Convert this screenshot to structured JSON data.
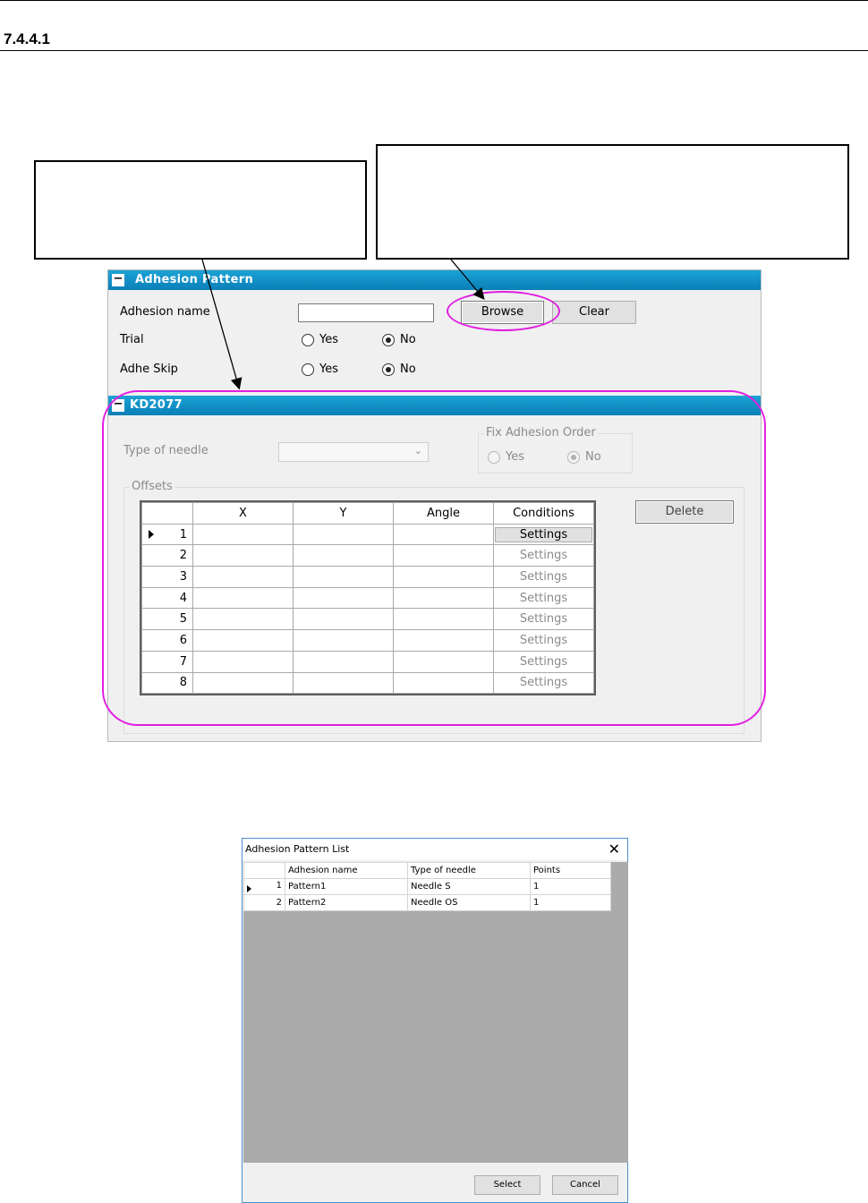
{
  "page": {
    "section_number": "7.4.4.1"
  },
  "adhesion_pattern": {
    "header": "Adhesion Pattern",
    "collapse_glyph": "−",
    "adhesion_name_label": "Adhesion name",
    "adhesion_name_value": "",
    "browse_label": "Browse",
    "clear_label": "Clear",
    "trial_label": "Trial",
    "adhe_skip_label": "Adhe Skip",
    "yes_label": "Yes",
    "no_label": "No",
    "trial_selected": "No",
    "adhe_skip_selected": "No"
  },
  "kd_section": {
    "header": "KD2077",
    "type_of_needle_label": "Type of needle",
    "type_of_needle_value": "",
    "fix_order_label": "Fix Adhesion Order",
    "yes_label": "Yes",
    "no_label": "No",
    "fix_order_selected": "No",
    "offsets_label": "Offsets",
    "delete_label": "Delete",
    "columns": [
      "",
      "X",
      "Y",
      "Angle",
      "Conditions"
    ],
    "rows": [
      {
        "num": "1",
        "x": "",
        "y": "",
        "angle": "",
        "cond": "Settings"
      },
      {
        "num": "2",
        "x": "",
        "y": "",
        "angle": "",
        "cond": "Settings"
      },
      {
        "num": "3",
        "x": "",
        "y": "",
        "angle": "",
        "cond": "Settings"
      },
      {
        "num": "4",
        "x": "",
        "y": "",
        "angle": "",
        "cond": "Settings"
      },
      {
        "num": "5",
        "x": "",
        "y": "",
        "angle": "",
        "cond": "Settings"
      },
      {
        "num": "6",
        "x": "",
        "y": "",
        "angle": "",
        "cond": "Settings"
      },
      {
        "num": "7",
        "x": "",
        "y": "",
        "angle": "",
        "cond": "Settings"
      },
      {
        "num": "8",
        "x": "",
        "y": "",
        "angle": "",
        "cond": "Settings"
      }
    ]
  },
  "colors": {
    "highlight": "#e11ee1",
    "header_bar": "#1591c9"
  },
  "dialog": {
    "title": "Adhesion Pattern List",
    "close_glyph": "✕",
    "columns": [
      "",
      "Adhesion name",
      "Type of needle",
      "Points"
    ],
    "rows": [
      {
        "num": "1",
        "name": "Pattern1",
        "needle": "Needle S",
        "points": "1"
      },
      {
        "num": "2",
        "name": "Pattern2",
        "needle": "Needle OS",
        "points": "1"
      }
    ],
    "select_label": "Select",
    "cancel_label": "Cancel"
  }
}
